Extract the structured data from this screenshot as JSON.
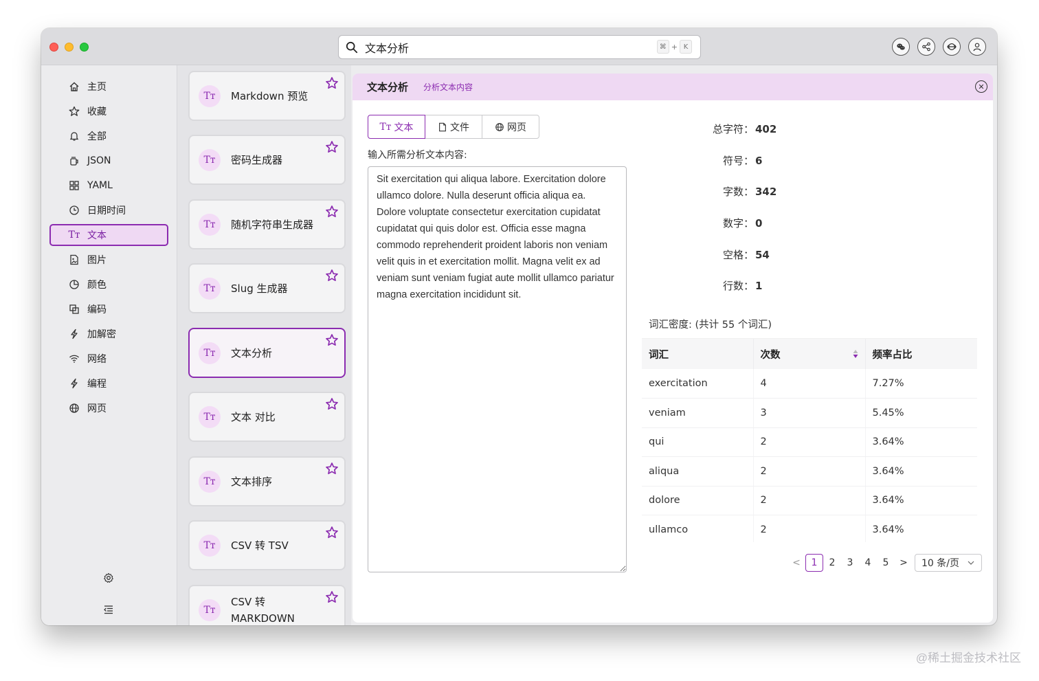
{
  "search": {
    "value": "文本分析",
    "shortcut_cmd": "⌘",
    "shortcut_plus": "+",
    "shortcut_key": "K"
  },
  "header_icons": [
    "wechat-icon",
    "share-icon",
    "sync-icon",
    "user-icon"
  ],
  "sidebar": {
    "items": [
      {
        "label": "主页",
        "icon": "home-icon"
      },
      {
        "label": "收藏",
        "icon": "star-icon"
      },
      {
        "label": "全部",
        "icon": "bell-icon"
      },
      {
        "label": "JSON",
        "icon": "json-icon"
      },
      {
        "label": "YAML",
        "icon": "grid-icon"
      },
      {
        "label": "日期时间",
        "icon": "clock-icon"
      },
      {
        "label": "文本",
        "icon": "text-icon",
        "active": true
      },
      {
        "label": "图片",
        "icon": "image-icon"
      },
      {
        "label": "颜色",
        "icon": "color-icon"
      },
      {
        "label": "编码",
        "icon": "encode-icon"
      },
      {
        "label": "加解密",
        "icon": "bolt-icon"
      },
      {
        "label": "网络",
        "icon": "wifi-icon"
      },
      {
        "label": "编程",
        "icon": "code-icon"
      },
      {
        "label": "网页",
        "icon": "globe-icon"
      }
    ]
  },
  "tools": [
    {
      "badge": "Tт",
      "name": "Markdown 预览"
    },
    {
      "badge": "Tт",
      "name": "密码生成器"
    },
    {
      "badge": "Tт",
      "name": "随机字符串生成器"
    },
    {
      "badge": "Tт",
      "name": "Slug 生成器"
    },
    {
      "badge": "Tт",
      "name": "文本分析",
      "active": true
    },
    {
      "badge": "Tт",
      "name": "文本 对比"
    },
    {
      "badge": "Tт",
      "name": "文本排序"
    },
    {
      "badge": "Tт",
      "name": "CSV 转 TSV"
    },
    {
      "badge": "Tт",
      "name": "CSV 转 MARKDOWN"
    }
  ],
  "main": {
    "title": "文本分析",
    "subtitle": "分析文本内容",
    "close": "✕",
    "tabs": [
      {
        "label": "文本",
        "icon": "text-icon",
        "active": true
      },
      {
        "label": "文件",
        "icon": "file-icon"
      },
      {
        "label": "网页",
        "icon": "globe-icon"
      }
    ],
    "input_label": "输入所需分析文本内容:",
    "input_text": "Sit exercitation qui aliqua labore. Exercitation dolore ullamco dolore. Nulla deserunt officia aliqua ea. Dolore voluptate consectetur exercitation cupidatat cupidatat qui quis dolor est. Officia esse magna commodo reprehenderit proident laboris non veniam velit quis in et exercitation mollit. Magna velit ex ad veniam sunt veniam fugiat aute mollit ullamco pariatur magna exercitation incididunt sit.",
    "stats": [
      {
        "label": "总字符：",
        "value": "402"
      },
      {
        "label": "符号：",
        "value": "6"
      },
      {
        "label": "字数：",
        "value": "342"
      },
      {
        "label": "数字：",
        "value": "0"
      },
      {
        "label": "空格：",
        "value": "54"
      },
      {
        "label": "行数：",
        "value": "1"
      }
    ],
    "density_title": "词汇密度: (共计 55 个词汇)",
    "table": {
      "headers": [
        "词汇",
        "次数",
        "频率占比"
      ],
      "rows": [
        [
          "exercitation",
          "4",
          "7.27%"
        ],
        [
          "veniam",
          "3",
          "5.45%"
        ],
        [
          "qui",
          "2",
          "3.64%"
        ],
        [
          "aliqua",
          "2",
          "3.64%"
        ],
        [
          "dolore",
          "2",
          "3.64%"
        ],
        [
          "ullamco",
          "2",
          "3.64%"
        ]
      ]
    },
    "pagination": {
      "prev": "<",
      "next": ">",
      "pages": [
        "1",
        "2",
        "3",
        "4",
        "5"
      ],
      "current": "1",
      "page_size": "10 条/页"
    }
  },
  "colors": {
    "accent": "#8b2bb0",
    "accent_bg": "#efd9f3"
  },
  "watermark": "@稀土掘金技术社区"
}
